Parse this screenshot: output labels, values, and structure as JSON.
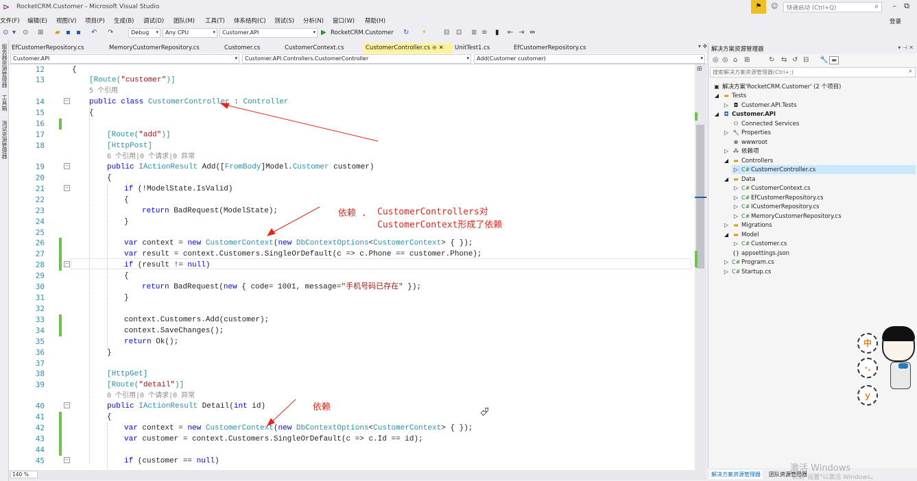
{
  "window": {
    "title": "RocketCRM.Customer - Microsoft Visual Studio",
    "quick_launch": "快速启动 (Ctrl+Q)",
    "login": "登录"
  },
  "menu": [
    "文件(F)",
    "编辑(E)",
    "视图(V)",
    "项目(P)",
    "生成(B)",
    "调试(D)",
    "团队(M)",
    "工具(T)",
    "体系结构(C)",
    "测试(S)",
    "分析(N)",
    "窗口(W)",
    "帮助(H)"
  ],
  "toolbar": {
    "config": "Debug",
    "platform": "Any CPU",
    "startup": "Customer.API",
    "run": "RocketCRM.Customer"
  },
  "left_rail": [
    "服务器资源管理器",
    "工具箱",
    "测试资源管理器"
  ],
  "doc_tabs": [
    "EfCustomerRepository.cs",
    "MemoryCustomerRepository.cs",
    "Customer.cs",
    "CustomerContext.cs",
    "CustomerController.cs",
    "UnitTest1.cs",
    "EfCustomerRepository.cs"
  ],
  "nav": {
    "project": "Customer.API",
    "class": "Customer.API.Controllers.CustomerController",
    "member": "Add(Customer customer)"
  },
  "code": {
    "lines": [
      "12",
      "13",
      "",
      "14",
      "15",
      "16",
      "17",
      "18",
      "",
      "19",
      "20",
      "21",
      "22",
      "23",
      "24",
      "25",
      "26",
      "27",
      "28",
      "29",
      "30",
      "31",
      "32",
      "33",
      "34",
      "35",
      "36",
      "37",
      "38",
      "39",
      "",
      "40",
      "41",
      "42",
      "43",
      "44",
      "45"
    ],
    "l12": "{",
    "l13a": "[Route(",
    "l13b": "\"customer\"",
    "l13c": ")]",
    "lens1": "5 个引用",
    "l14a": "public",
    "l14b": "class",
    "l14c": "CustomerController",
    "l14d": " : ",
    "l14e": "Controller",
    "l15": "{",
    "l17a": "[Route(",
    "l17b": "\"add\"",
    "l17c": ")]",
    "l18": "[HttpPost]",
    "lens2": "6 个引用|0 个请求|0 异常",
    "l19a": "public",
    "l19b": "IActionResult",
    "l19c": " Add([",
    "l19d": "FromBody",
    "l19e": "]Model.",
    "l19f": "Customer",
    "l19g": " customer)",
    "l20": "{",
    "l21a": "if",
    "l21b": " (!ModelState.IsValid)",
    "l22": "{",
    "l23a": "return",
    "l23b": " BadRequest(ModelState);",
    "l24": "}",
    "l26a": "var",
    "l26b": " context = ",
    "l26c": "new",
    "l26d": "CustomerContext",
    "l26e": "(",
    "l26f": "new",
    "l26g": "DbContextOptions",
    "l26h": "<",
    "l26i": "CustomerContext",
    "l26j": "> { });",
    "l27a": "var",
    "l27b": " result = context.Customers.SingleOrDefault(c => c.Phone == customer.Phone);",
    "l28a": "if",
    "l28b": " (result != ",
    "l28c": "null",
    "l28d": ")",
    "l29": "{",
    "l30a": "return",
    "l30b": " BadRequest(",
    "l30c": "new",
    "l30d": " { code= 1001, message=",
    "l30e": "\"手机号码已存在\"",
    "l30f": " });",
    "l31": "}",
    "l33": "context.Customers.Add(customer);",
    "l34": "context.SaveChanges();",
    "l35a": "return",
    "l35b": " Ok();",
    "l36": "}",
    "l38": "[HttpGet]",
    "l39a": "[Route(",
    "l39b": "\"detail\"",
    "l39c": ")]",
    "lens3": "0 个引用|0 个请求|0 异常",
    "l40a": "public",
    "l40b": "IActionResult",
    "l40c": " Detail(",
    "l40d": "int",
    "l40e": " id)",
    "l41": "{",
    "l42a": "var",
    "l42b": " context = ",
    "l42c": "new",
    "l42d": "CustomerContext",
    "l42e": "(",
    "l42f": "new",
    "l42g": "DbContextOptions",
    "l42h": "<",
    "l42i": "CustomerContext",
    "l42j": "> { });",
    "l43a": "var",
    "l43b": " customer = context.Customers.SingleOrDefault(c => c.Id == id);",
    "l45a": "if",
    "l45b": " (customer == ",
    "l45c": "null",
    "l45d": ")"
  },
  "annotations": {
    "a1": "依赖 .",
    "a2": "CustomerControllers对",
    "a3": "CustomerContext形成了依赖",
    "a4": "依赖"
  },
  "zoom": "140 %",
  "solution_explorer": {
    "title": "解决方案资源管理器",
    "search": "搜索解决方案资源管理器(Ctrl+;)",
    "items": [
      "解决方案'RocketCRM.Customer' (2 个项目)",
      "Tests",
      "Customer.API.Tests",
      "Customer.API",
      "Connected Services",
      "Properties",
      "wwwroot",
      "依赖项",
      "Controllers",
      "CustomerController.cs",
      "Data",
      "CustomerContext.cs",
      "EfCustomerRepository.cs",
      "ICustomerRepository.cs",
      "MemoryCustomerRepository.cs",
      "Migrations",
      "Model",
      "Customer.cs",
      "appsettings.json",
      "Program.cs",
      "Startup.cs"
    ],
    "tabs": [
      "解决方案资源管理器",
      "团队资源管理器"
    ]
  },
  "watermark": {
    "line1": "激活 Windows",
    "line2": "转到\"设置\"以激活 Windows。"
  },
  "stickers": [
    "中",
    "·.",
    "ｙ"
  ]
}
